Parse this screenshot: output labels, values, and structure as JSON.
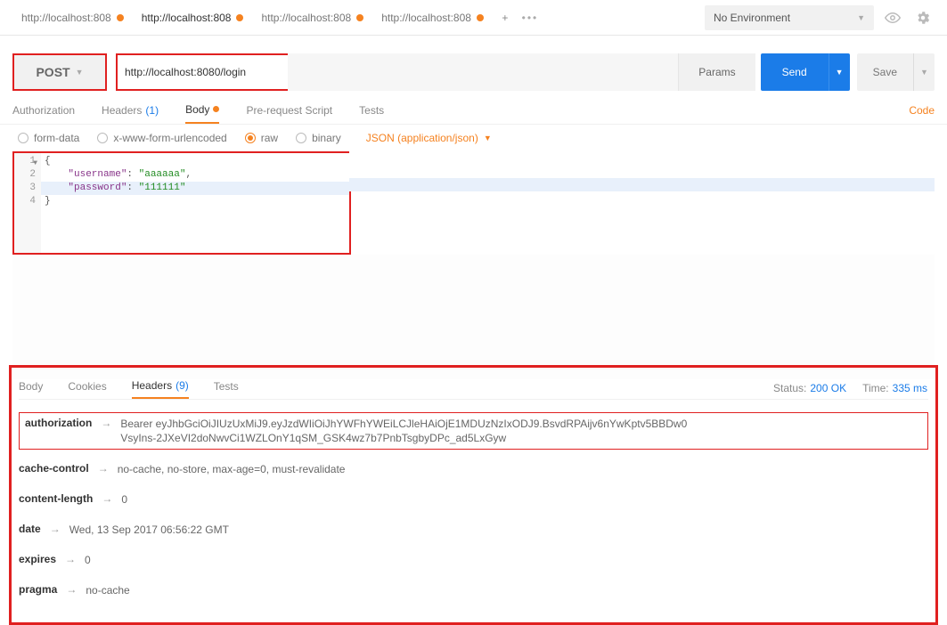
{
  "environment": {
    "label": "No Environment"
  },
  "tabs": [
    {
      "label": "http://localhost:808",
      "active": false
    },
    {
      "label": "http://localhost:808",
      "active": true
    },
    {
      "label": "http://localhost:808",
      "active": false
    },
    {
      "label": "http://localhost:808",
      "active": false
    }
  ],
  "request": {
    "method": "POST",
    "url": "http://localhost:8080/login",
    "params_label": "Params",
    "send_label": "Send",
    "save_label": "Save"
  },
  "req_tabs": {
    "authorization": "Authorization",
    "headers": "Headers",
    "headers_count": "(1)",
    "body": "Body",
    "pre": "Pre-request Script",
    "tests": "Tests",
    "code": "Code"
  },
  "body_opts": {
    "form_data": "form-data",
    "urlenc": "x-www-form-urlencoded",
    "raw": "raw",
    "binary": "binary",
    "mime": "JSON (application/json)"
  },
  "code_editor": {
    "line1": "{",
    "line2_key": "\"username\"",
    "line2_val": "\"aaaaaa\"",
    "line3_key": "\"password\"",
    "line3_val": "\"111111\"",
    "line4": "}",
    "gutter": [
      "1",
      "2",
      "3",
      "4"
    ]
  },
  "resp_tabs": {
    "body": "Body",
    "cookies": "Cookies",
    "headers": "Headers",
    "headers_count": "(9)",
    "tests": "Tests"
  },
  "status": {
    "label": "Status:",
    "value": "200 OK"
  },
  "time": {
    "label": "Time:",
    "value": "335 ms"
  },
  "response_headers": [
    {
      "name": "authorization",
      "value": "Bearer eyJhbGciOiJIUzUxMiJ9.eyJzdWIiOiJhYWFhYWEiLCJleHAiOjE1MDUzNzIxODJ9.BsvdRPAijv6nYwKptv5BBDw0VsyIns-2JXeVI2doNwvCi1WZLOnY1qSM_GSK4wz7b7PnbTsgbyDPc_ad5LxGyw",
      "boxed": true
    },
    {
      "name": "cache-control",
      "value": "no-cache, no-store, max-age=0, must-revalidate",
      "boxed": false
    },
    {
      "name": "content-length",
      "value": "0",
      "boxed": false
    },
    {
      "name": "date",
      "value": "Wed, 13 Sep 2017 06:56:22 GMT",
      "boxed": false
    },
    {
      "name": "expires",
      "value": "0",
      "boxed": false
    },
    {
      "name": "pragma",
      "value": "no-cache",
      "boxed": false
    }
  ]
}
